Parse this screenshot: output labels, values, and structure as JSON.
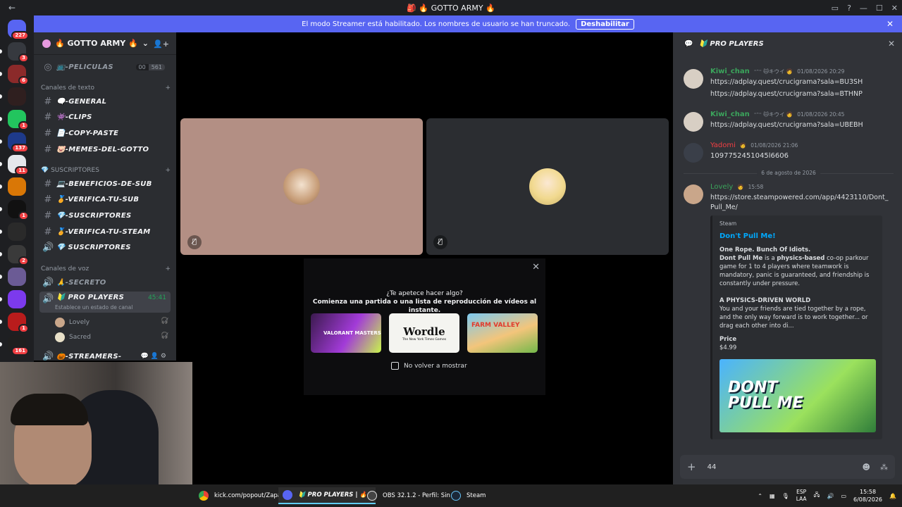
{
  "window": {
    "title": "🎒 🔥 GOTTO ARMY 🔥",
    "back_icon": "←"
  },
  "banner": {
    "text": "El modo Streamer está habilitado. Los nombres de usuario se han truncado.",
    "button": "Deshabilitar"
  },
  "guilds": [
    {
      "badge": "227"
    },
    {
      "badge": "3"
    },
    {
      "badge": "6"
    },
    {
      "badge": ""
    },
    {
      "badge": "1"
    },
    {
      "badge": "137"
    },
    {
      "badge": "11"
    },
    {
      "badge": ""
    },
    {
      "badge": "1"
    },
    {
      "badge": ""
    },
    {
      "badge": "2"
    },
    {
      "badge": ""
    },
    {
      "badge": ""
    },
    {
      "badge": "1"
    },
    {
      "badge": "161"
    }
  ],
  "server": {
    "name": "🔥 GOTTO ARMY 🔥"
  },
  "channels": {
    "peliculas": {
      "name": "📺-PELICULAS",
      "count_a": "00",
      "count_b": "561"
    },
    "text_category": "Canales de texto",
    "text": [
      "🗨️-GENERAL",
      "👾-CLIPS",
      "📄-COPY-PASTE",
      "🐷-MEMES-DEL-GOTTO"
    ],
    "subs_category": "💎 SUSCRIPTORES",
    "subs": [
      "💻-BENEFICIOS-DE-SUB",
      "🏅-VERIFICA-TU-SUB",
      "💎-SUSCRIPTORES",
      "🏅-VERIFICA-TU-STEAM",
      "💎 SUSCRIPTORES"
    ],
    "voice_category": "Canales de voz",
    "voice": {
      "secreto": "🙏-SECRETO",
      "pro": "🔰 PRO PLAYERS",
      "pro_time": "45:41",
      "status": "Establece un estado de canal",
      "user1": "Lovely",
      "user2": "Sacred",
      "streamers": "🎃-STREAMERS-"
    }
  },
  "activity": {
    "title": "¿Te apetece hacer algo?",
    "subtitle": "Comienza una partida o una lista de reproducción de vídeos al instante.",
    "games": [
      "VALORANT MASTERS",
      "Wordle",
      "FARM VALLEY"
    ],
    "wordle_sub": "The New York Times Games",
    "checkbox": "No volver a mostrar"
  },
  "chat": {
    "title": "🔰 PRO PLAYERS",
    "messages": [
      {
        "user": "Kiwi_chan",
        "tags": "⁼ᵔ⁼ 🐱キウイ 🧑",
        "time": "01/08/2026 20:29",
        "lines": [
          "https://adplay.quest/crucigrama?sala=BU3SH",
          "https://adplay.quest/crucigrama?sala=BTHNP"
        ],
        "color": "#3ba55c"
      },
      {
        "user": "Kiwi_chan",
        "tags": "⁼ᵔ⁼ 🐱キウイ 🧑",
        "time": "01/08/2026 20:45",
        "lines": [
          "https://adplay.quest/crucigrama?sala=UBEBH"
        ],
        "color": "#3ba55c"
      },
      {
        "user": "Yadomi",
        "tags": "🧑",
        "time": "01/08/2026 21:06",
        "lines": [
          "1097752451045l6606"
        ],
        "color": "#f23f43"
      }
    ],
    "divider": "6 de agosto de 2026",
    "lovely": {
      "user": "Lovely",
      "tags": "🧑",
      "time": "15:58",
      "link1": "https://store.steampowered.com/app/4423110/Dont_",
      "link2": "Pull_Me/"
    },
    "embed": {
      "provider": "Steam",
      "title": "Don't Pull Me!",
      "bold1": "One Rope. Bunch Of Idiots.",
      "p1a": "Dont Pull Me",
      "p1b": " is a ",
      "p1c": "physics-based",
      "p1d": " co-op parkour game for 1 to 4 players where teamwork is mandatory, panic is guaranteed, and friendship is constantly under pressure.",
      "bold2": "A PHYSICS-DRIVEN WORLD",
      "p2": "You and your friends are tied together by a rope, and the only way forward is to work together... or drag each other into di...",
      "price_label": "Price",
      "price": "$4.99",
      "image_text1": "DONT",
      "image_text2": "PULL ME"
    },
    "composer_value": "44"
  },
  "taskbar": {
    "items": [
      "kick.com/popout/Zapat",
      "🔰 PRO PLAYERS | 🔥 ·",
      "OBS 32.1.2 - Perfil: Sin Tí",
      "Steam"
    ],
    "lang1": "ESP",
    "lang2": "LAA",
    "time": "15:58",
    "date": "6/08/2026"
  }
}
